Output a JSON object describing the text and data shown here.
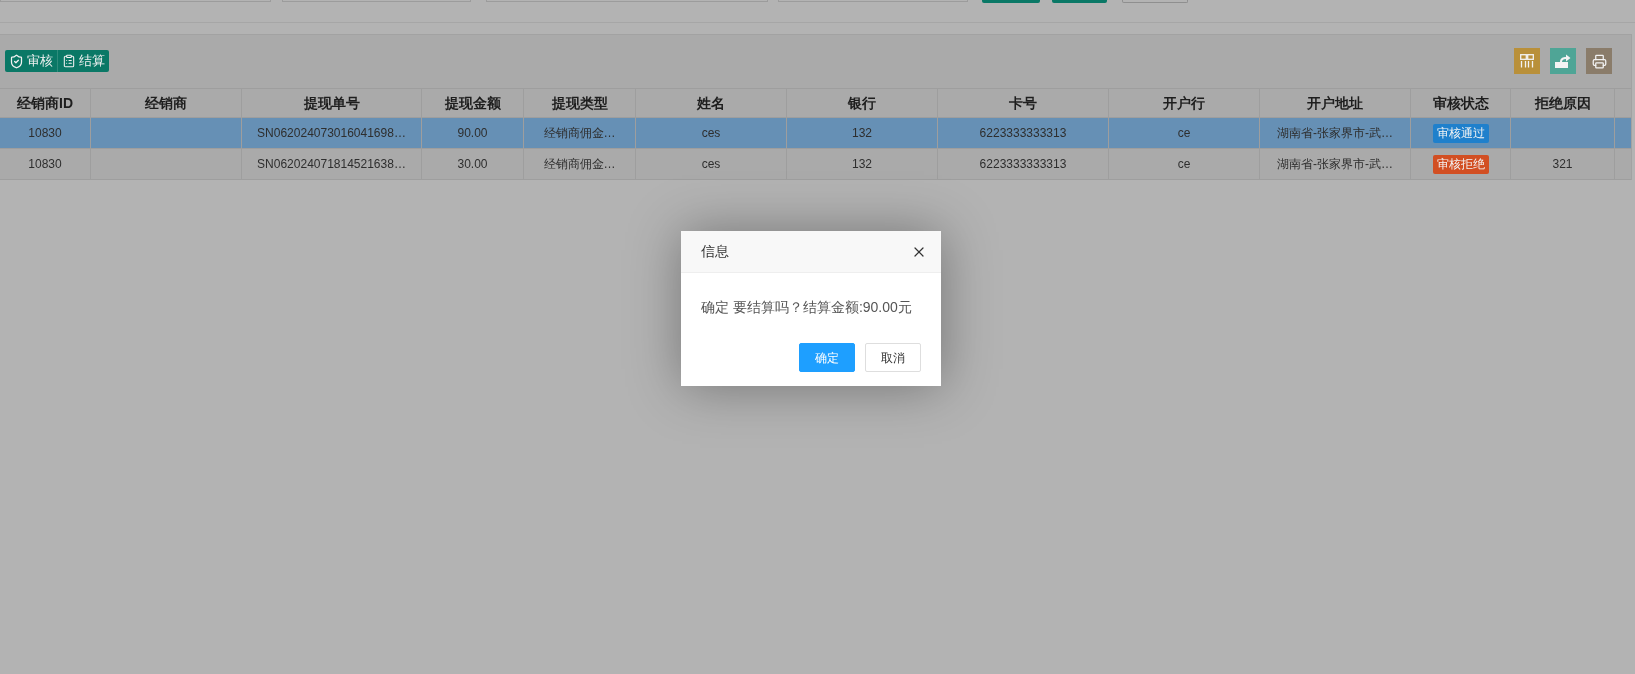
{
  "toolbar": {
    "buttons": [
      {
        "label": "审核"
      },
      {
        "label": "结算"
      }
    ],
    "tools": [
      {
        "color": "#b9903a"
      },
      {
        "color": "#4fa596"
      },
      {
        "color": "#8a7c6a"
      }
    ]
  },
  "table": {
    "columns": [
      "经销商ID",
      "经销商",
      "提现单号",
      "提现金额",
      "提现类型",
      "姓名",
      "银行",
      "卡号",
      "开户行",
      "开户地址",
      "审核状态",
      "拒绝原因"
    ],
    "rows": [
      {
        "selected": true,
        "dealer_id": "10830",
        "withdrawal_no": "SN062024073016041698…",
        "amount": "90.00",
        "type": "经销商佣金…",
        "name": "ces",
        "bank": "132",
        "card_no": "6223333333313",
        "branch": "ce",
        "address": "湖南省-张家界市-武…",
        "status": {
          "label": "审核通过",
          "color": "#1f80cc"
        }
      },
      {
        "selected": false,
        "dealer_id": "10830",
        "withdrawal_no": "SN062024071814521638…",
        "amount": "30.00",
        "type": "经销商佣金…",
        "name": "ces",
        "bank": "132",
        "card_no": "6223333333313",
        "branch": "ce",
        "address": "湖南省-张家界市-武…",
        "status": {
          "label": "审核拒绝",
          "color": "#d24f23"
        },
        "reject_reason": "321"
      }
    ]
  },
  "dialog": {
    "title": "信息",
    "message": "确定 要结算吗？结算金额:90.00元",
    "buttons": [
      {
        "label": "确定",
        "kind": "primary"
      },
      {
        "label": "取消",
        "kind": "secondary"
      }
    ]
  }
}
